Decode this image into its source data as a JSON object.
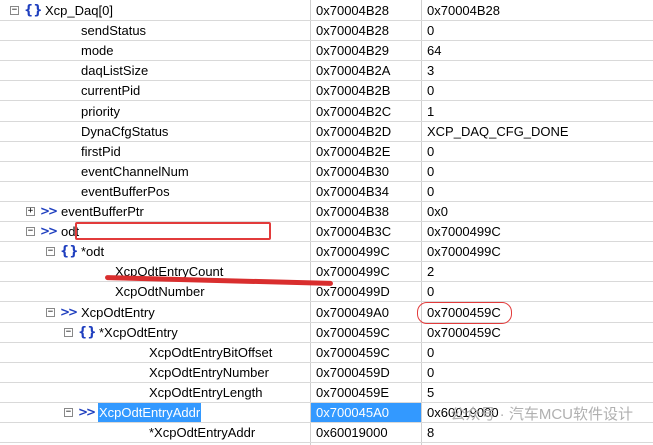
{
  "rows": [
    {
      "name": "Xcp_Daq[0]",
      "addr": "0x70004B28",
      "value": "0x70004B28",
      "exp": "−",
      "icon": "brace"
    },
    {
      "name": "sendStatus",
      "addr": "0x70004B28",
      "value": "0",
      "exp": "",
      "icon": ""
    },
    {
      "name": "mode",
      "addr": "0x70004B29",
      "value": "64",
      "exp": "",
      "icon": ""
    },
    {
      "name": "daqListSize",
      "addr": "0x70004B2A",
      "value": "3",
      "exp": "",
      "icon": ""
    },
    {
      "name": "currentPid",
      "addr": "0x70004B2B",
      "value": "0",
      "exp": "",
      "icon": ""
    },
    {
      "name": "priority",
      "addr": "0x70004B2C",
      "value": "1",
      "exp": "",
      "icon": ""
    },
    {
      "name": "DynaCfgStatus",
      "addr": "0x70004B2D",
      "value": "XCP_DAQ_CFG_DONE",
      "exp": "",
      "icon": ""
    },
    {
      "name": "firstPid",
      "addr": "0x70004B2E",
      "value": "0",
      "exp": "",
      "icon": ""
    },
    {
      "name": "eventChannelNum",
      "addr": "0x70004B30",
      "value": "0",
      "exp": "",
      "icon": ""
    },
    {
      "name": "eventBufferPos",
      "addr": "0x70004B34",
      "value": "0",
      "exp": "",
      "icon": ""
    },
    {
      "name": "eventBufferPtr",
      "addr": "0x70004B38",
      "value": "0x0",
      "exp": "+",
      "icon": "ptr"
    },
    {
      "name": "odt",
      "addr": "0x70004B3C",
      "value": "0x7000499C",
      "exp": "−",
      "icon": "ptr"
    },
    {
      "name": "*odt",
      "addr": "0x7000499C",
      "value": "0x7000499C",
      "exp": "−",
      "icon": "brace"
    },
    {
      "name": "XcpOdtEntryCount",
      "addr": "0x7000499C",
      "value": "2",
      "exp": "",
      "icon": ""
    },
    {
      "name": "XcpOdtNumber",
      "addr": "0x7000499D",
      "value": "0",
      "exp": "",
      "icon": ""
    },
    {
      "name": "XcpOdtEntry",
      "addr": "0x700049A0",
      "value": "0x7000459C",
      "exp": "−",
      "icon": "ptr"
    },
    {
      "name": "*XcpOdtEntry",
      "addr": "0x7000459C",
      "value": "0x7000459C",
      "exp": "−",
      "icon": "brace"
    },
    {
      "name": "XcpOdtEntryBitOffset",
      "addr": "0x7000459C",
      "value": "0",
      "exp": "",
      "icon": ""
    },
    {
      "name": "XcpOdtEntryNumber",
      "addr": "0x7000459D",
      "value": "0",
      "exp": "",
      "icon": ""
    },
    {
      "name": "XcpOdtEntryLength",
      "addr": "0x7000459E",
      "value": "5",
      "exp": "",
      "icon": ""
    },
    {
      "name": "XcpOdtEntryAddr",
      "addr": "0x700045A0",
      "value": "0x60019000",
      "exp": "−",
      "icon": "ptr"
    },
    {
      "name": "*XcpOdtEntryAddr",
      "addr": "0x60019000",
      "value": "8",
      "exp": "",
      "icon": ""
    }
  ],
  "icons": {
    "brace": "{}",
    "ptr": ">>"
  },
  "watermark": "公众号 · 汽车MCU软件设计"
}
